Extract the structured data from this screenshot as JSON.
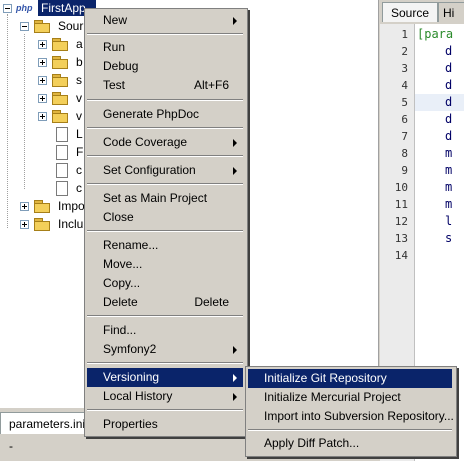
{
  "project_tree": {
    "project_name": "FirstApp - ",
    "project_icon_text": "php",
    "nodes": [
      {
        "label": "Sour",
        "icon": "folder-icon"
      },
      {
        "label": "a",
        "icon": "folder-icon"
      },
      {
        "label": "b",
        "icon": "folder-icon"
      },
      {
        "label": "s",
        "icon": "folder-icon"
      },
      {
        "label": "v",
        "icon": "folder-icon"
      },
      {
        "label": "v",
        "icon": "folder-icon"
      },
      {
        "label": "L",
        "icon": "file-icon"
      },
      {
        "label": "F",
        "icon": "file-icon"
      },
      {
        "label": "c",
        "icon": "file-icon"
      },
      {
        "label": "c",
        "icon": "file-icon"
      },
      {
        "label": "Impo",
        "icon": "folder-icon"
      },
      {
        "label": "Inclu",
        "icon": "folder-icon"
      }
    ]
  },
  "bottom_tab": {
    "label": "parameters.ini -"
  },
  "editor": {
    "tabs": [
      "Source",
      "Hi"
    ],
    "line_numbers": [
      "1",
      "2",
      "3",
      "4",
      "5",
      "6",
      "7",
      "8",
      "9",
      "10",
      "11",
      "12",
      "13",
      "14"
    ],
    "code_lines": [
      "[para",
      "d",
      "d",
      "d",
      "d",
      "d",
      "d",
      "m",
      "m",
      "m",
      "m",
      "l",
      "s",
      ""
    ]
  },
  "context_menu": {
    "items": [
      {
        "label": "New",
        "submenu": true
      },
      {
        "label": "Run"
      },
      {
        "label": "Debug"
      },
      {
        "label": "Test",
        "shortcut": "Alt+F6"
      },
      {
        "label": "Generate PhpDoc"
      },
      {
        "label": "Code Coverage",
        "submenu": true
      },
      {
        "label": "Set Configuration",
        "submenu": true
      },
      {
        "label": "Set as Main Project"
      },
      {
        "label": "Close"
      },
      {
        "label": "Rename..."
      },
      {
        "label": "Move..."
      },
      {
        "label": "Copy..."
      },
      {
        "label": "Delete",
        "shortcut": "Delete"
      },
      {
        "label": "Find..."
      },
      {
        "label": "Symfony2",
        "submenu": true
      },
      {
        "label": "Versioning",
        "submenu": true,
        "selected": true
      },
      {
        "label": "Local History",
        "submenu": true
      },
      {
        "label": "Properties"
      }
    ]
  },
  "versioning_submenu": {
    "items": [
      {
        "label": "Initialize Git Repository",
        "selected": true
      },
      {
        "label": "Initialize Mercurial Project"
      },
      {
        "label": "Import into Subversion Repository..."
      },
      {
        "label": "Apply Diff Patch..."
      }
    ]
  },
  "colors": {
    "selection": "#0a246a",
    "menu_bg": "#d4d0c8"
  }
}
